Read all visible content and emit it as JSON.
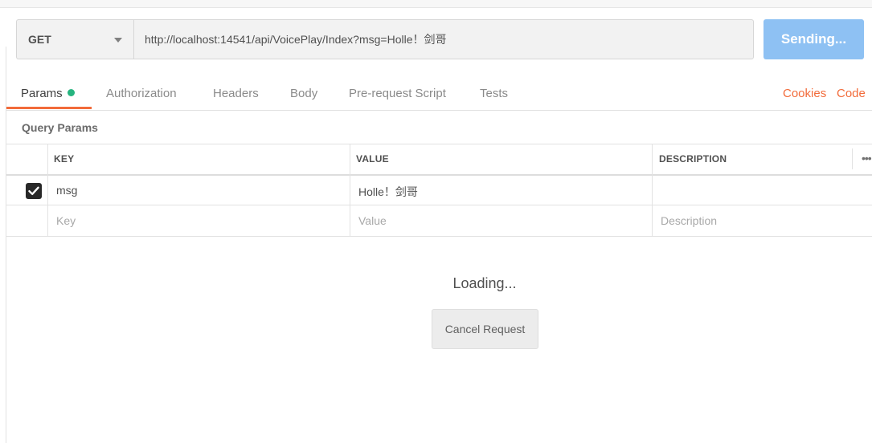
{
  "request": {
    "method": "GET",
    "url": "http://localhost:14541/api/VoicePlay/Index?msg=Holle！剑哥",
    "send_label": "Sending..."
  },
  "tabs": [
    {
      "label": "Params",
      "active": true
    },
    {
      "label": "Authorization"
    },
    {
      "label": "Headers"
    },
    {
      "label": "Body"
    },
    {
      "label": "Pre-request Script"
    },
    {
      "label": "Tests"
    }
  ],
  "links": {
    "cookies": "Cookies",
    "code": "Code"
  },
  "query_params": {
    "title": "Query Params",
    "columns": [
      "KEY",
      "VALUE",
      "DESCRIPTION"
    ],
    "rows": [
      {
        "checked": true,
        "key": "msg",
        "value": "Holle！剑哥",
        "description": ""
      }
    ],
    "placeholders": {
      "key": "Key",
      "value": "Value",
      "description": "Description"
    },
    "more_label": "•••"
  },
  "status": {
    "loading_text": "Loading...",
    "cancel_label": "Cancel Request"
  },
  "colors": {
    "accent": "#f26b3a",
    "send_button": "#8ec1f3",
    "param_dot": "#26b47f"
  }
}
